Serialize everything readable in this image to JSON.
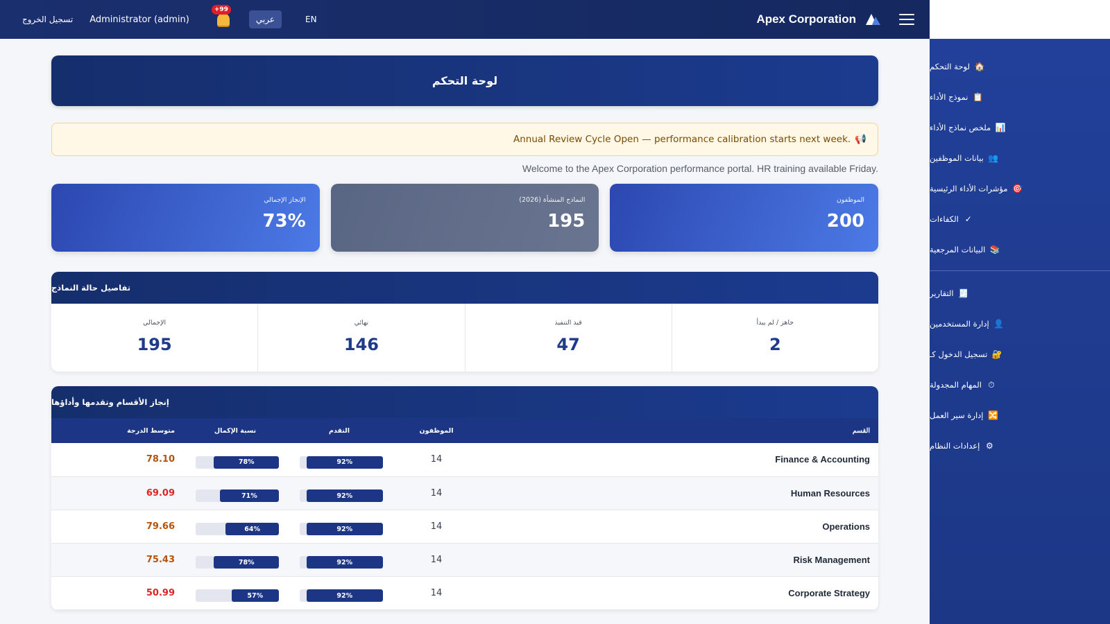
{
  "topbar": {
    "logout": "تسجيل الخروج",
    "user": "Administrator (admin)",
    "notif_badge": "+99",
    "lang_ar": "عربي",
    "lang_en": "EN",
    "brand": "Apex Corporation"
  },
  "sidebar": {
    "items": [
      {
        "label": "لوحة التحكم",
        "icon": "🏠"
      },
      {
        "label": "نموذج الأداء",
        "icon": "📋"
      },
      {
        "label": "ملخص نماذج الأداء",
        "icon": "📊"
      },
      {
        "label": "بيانات الموظفين",
        "icon": "👥"
      },
      {
        "label": "مؤشرات الأداء الرئيسية",
        "icon": "🎯"
      },
      {
        "label": "الكفاءات",
        "icon": "✓"
      },
      {
        "label": "البيانات المرجعية",
        "icon": "📚"
      }
    ],
    "items2": [
      {
        "label": "التقارير",
        "icon": "🧾"
      },
      {
        "label": "إدارة المستخدمين",
        "icon": "👤"
      },
      {
        "label": "تسجيل الدخول كـ",
        "icon": "🔐"
      },
      {
        "label": "المهام المجدولة",
        "icon": "⏱"
      },
      {
        "label": "إدارة سير العمل",
        "icon": "🔀"
      },
      {
        "label": "إعدادات النظام",
        "icon": "⚙"
      }
    ]
  },
  "main": {
    "page_title": "لوحة التحكم",
    "announcement": "Annual Review Cycle Open — performance calibration starts next week.",
    "announcement_icon": "📢",
    "welcome": "Welcome to the Apex Corporation performance portal. HR training available Friday."
  },
  "stats": [
    {
      "label": "الإنجاز الإجمالي",
      "value": "73%"
    },
    {
      "label": "النماذج المنشأة (2026)",
      "value": "195"
    },
    {
      "label": "الموظفون",
      "value": "200"
    }
  ],
  "status_panel": {
    "title": "تفاصيل حالة النماذج",
    "cells": [
      {
        "label": "الإجمالي",
        "value": "195"
      },
      {
        "label": "نهائي",
        "value": "146"
      },
      {
        "label": "قيد التنفيذ",
        "value": "47"
      },
      {
        "label": "جاهز / لم يبدأ",
        "value": "2"
      }
    ]
  },
  "dept_panel": {
    "title": "إنجاز الأقسام وتقدمها وأداؤها",
    "headers": {
      "department": "القسم",
      "employees": "الموظفون",
      "progress": "التقدم",
      "completion": "نسبة الإكمال",
      "avg_score": "متوسط الدرجة"
    },
    "rows": [
      {
        "name": "Finance & Accounting",
        "employees": "14",
        "progress": "92%",
        "progress_value": 92,
        "completion": "78%",
        "completion_value": 78,
        "score": "78.10",
        "score_level": "orange"
      },
      {
        "name": "Human Resources",
        "employees": "14",
        "progress": "92%",
        "progress_value": 92,
        "completion": "71%",
        "completion_value": 71,
        "score": "69.09",
        "score_level": "red"
      },
      {
        "name": "Operations",
        "employees": "14",
        "progress": "92%",
        "progress_value": 92,
        "completion": "64%",
        "completion_value": 64,
        "score": "79.66",
        "score_level": "orange"
      },
      {
        "name": "Risk Management",
        "employees": "14",
        "progress": "92%",
        "progress_value": 92,
        "completion": "78%",
        "completion_value": 78,
        "score": "75.43",
        "score_level": "orange"
      },
      {
        "name": "Corporate Strategy",
        "employees": "14",
        "progress": "92%",
        "progress_value": 92,
        "completion": "57%",
        "completion_value": 57,
        "score": "50.99",
        "score_level": "red"
      }
    ]
  },
  "colors": {
    "primary": "#1c3585",
    "sidebar": "#1e3a8a",
    "score_orange": "#b45309",
    "score_red": "#dc2626"
  }
}
